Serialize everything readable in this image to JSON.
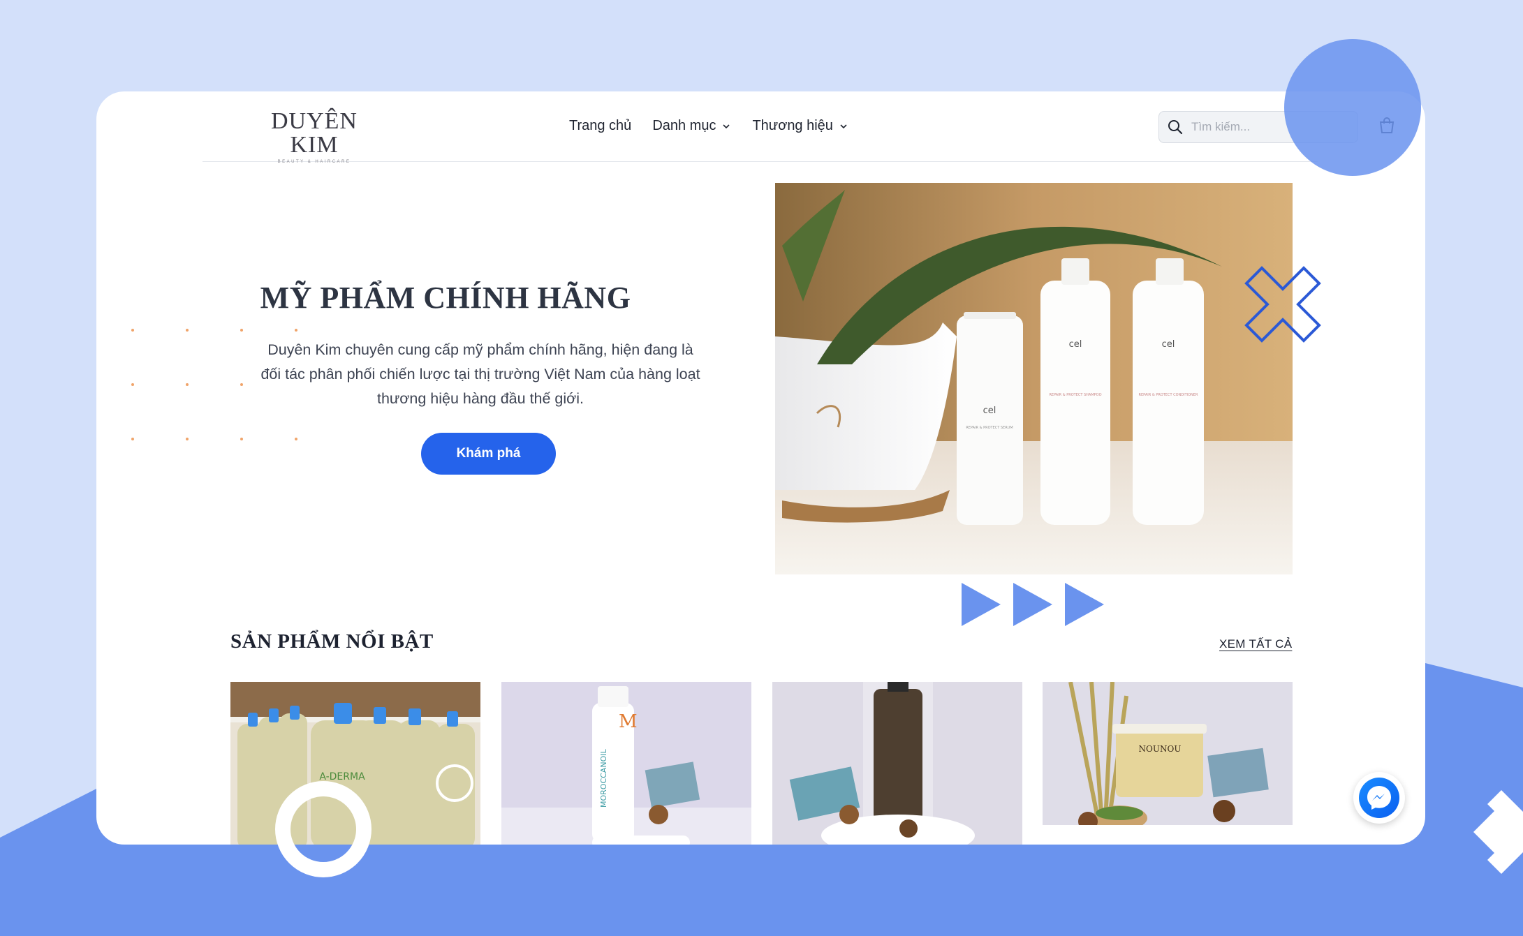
{
  "brand": {
    "logo_text": "DUYÊN KIM",
    "logo_tagline": "BEAUTY & HAIRCARE"
  },
  "nav": {
    "items": [
      {
        "label": "Trang chủ"
      },
      {
        "label": "Danh mục"
      },
      {
        "label": "Thương hiệu"
      }
    ]
  },
  "search": {
    "placeholder": "Tìm kiếm..."
  },
  "hero": {
    "title": "MỸ PHẨM CHÍNH HÃNG",
    "description": "Duyên Kim chuyên cung cấp mỹ phẩm chính hãng, hiện đang là đối tác phân phối chiến lược tại thị trường Việt Nam của hàng loạt thương hiệu hàng đầu thế giới.",
    "cta_label": "Khám phá",
    "image_labels": {
      "brand": "cel",
      "bottle1": "REPAIR & PROTECT SERUM",
      "bottle2": "REPAIR & PROTECT SHAMPOO",
      "bottle3": "REPAIR & PROTECT CONDITIONER"
    }
  },
  "featured": {
    "title": "SẢN PHẨM NỔI BẬT",
    "view_all_label": "XEM TẤT CẢ",
    "products": [
      {
        "name": "A-DERMA",
        "image_text": "A-DERMA"
      },
      {
        "name": "MOROCCANOIL",
        "image_text": "MOROCCANOIL"
      },
      {
        "name": "Hair oil bottle",
        "image_text": ""
      },
      {
        "name": "NOUNOU",
        "image_text": "NOUNOU"
      }
    ]
  },
  "colors": {
    "accent": "#2563eb",
    "background": "#d3e0fa",
    "band": "#6a93ee",
    "card": "#ffffff"
  }
}
